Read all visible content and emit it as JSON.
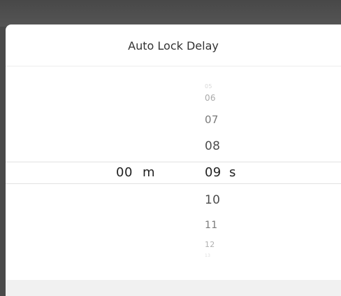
{
  "dialog": {
    "title": "Auto Lock Delay"
  },
  "picker": {
    "minutes": {
      "selected": "00",
      "unit": "m"
    },
    "seconds": {
      "unit": "s",
      "items": [
        {
          "label": "05"
        },
        {
          "label": "06"
        },
        {
          "label": "07"
        },
        {
          "label": "08"
        },
        {
          "label": "09"
        },
        {
          "label": "10"
        },
        {
          "label": "11"
        },
        {
          "label": "12"
        },
        {
          "label": "13"
        }
      ],
      "selected": "09"
    }
  }
}
